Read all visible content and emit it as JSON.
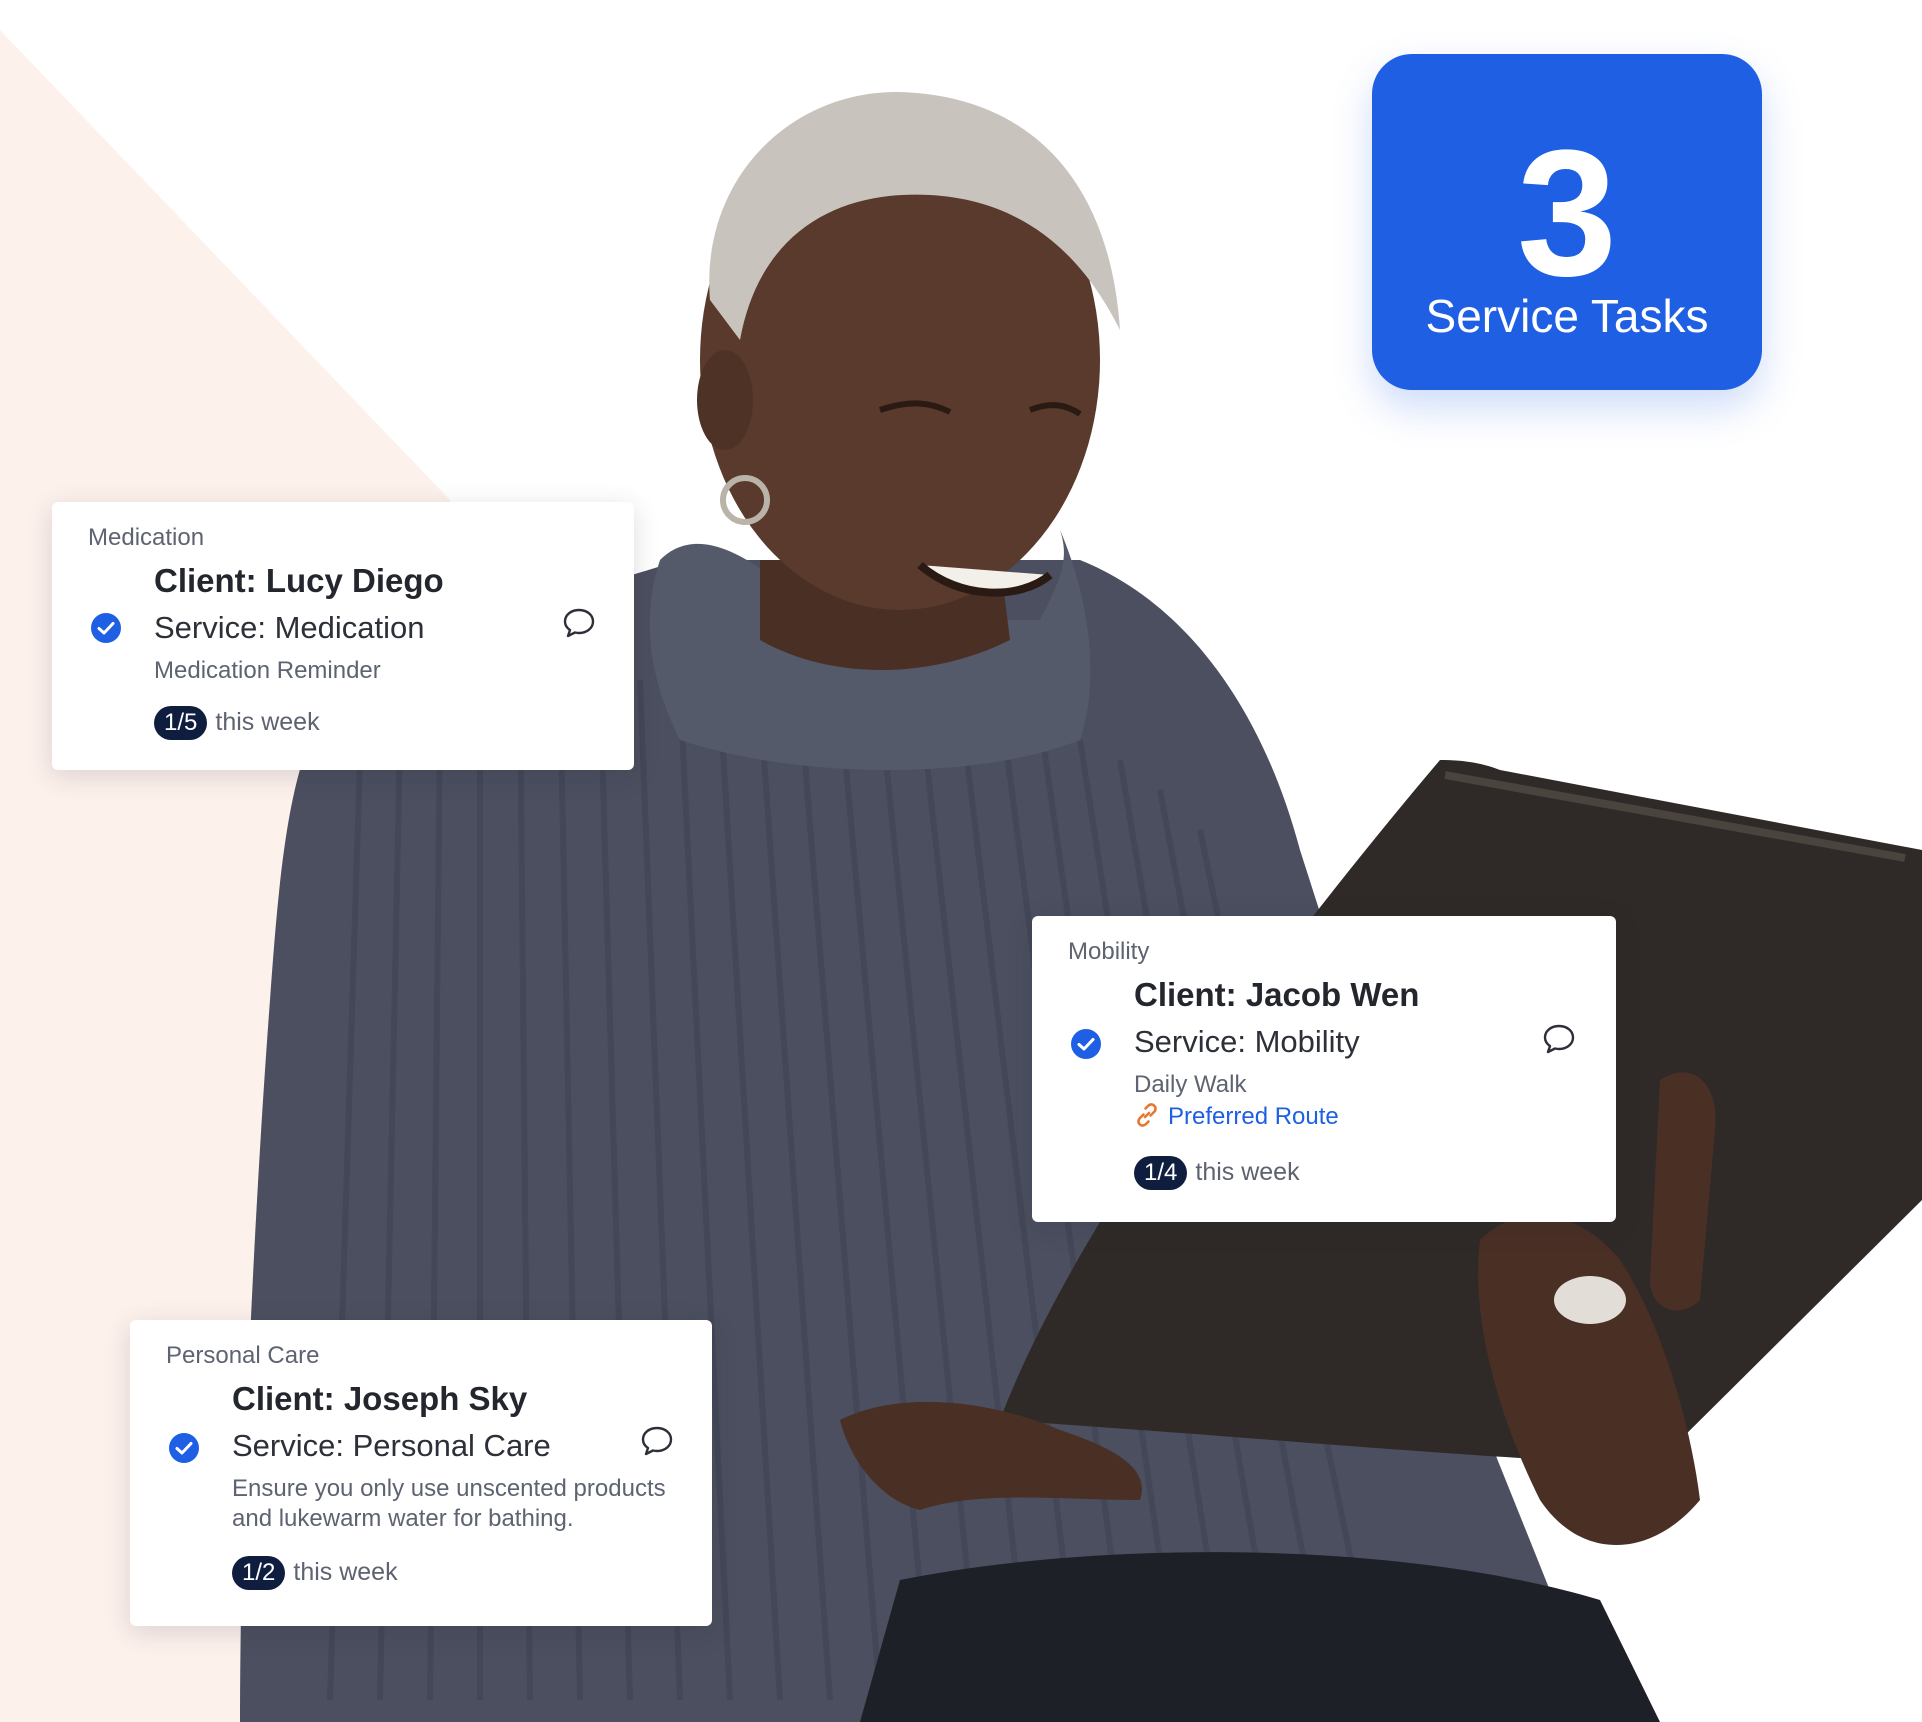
{
  "stat": {
    "number": "3",
    "label": "Service Tasks"
  },
  "cards": [
    {
      "category": "Medication",
      "client": "Client: Lucy Diego",
      "service": "Service: Medication",
      "note": "Medication Reminder",
      "progress": "1/5",
      "progress_suffix": "this week"
    },
    {
      "category": "Mobility",
      "client": "Client: Jacob Wen",
      "service": "Service: Mobility",
      "note": "Daily Walk",
      "link": "Preferred Route",
      "progress": "1/4",
      "progress_suffix": "this week"
    },
    {
      "category": "Personal Care",
      "client": "Client: Joseph Sky",
      "service": "Service: Personal Care",
      "note": "Ensure you only use unscented products and lukewarm water for bathing.",
      "progress": "1/2",
      "progress_suffix": "this week"
    }
  ],
  "icons": {
    "check": "check-circle-icon",
    "comment": "comment-icon",
    "link": "link-icon"
  },
  "colors": {
    "accent": "#1f5fe3",
    "badge": "#0f1e3f",
    "background_triangle": "#fdf1ec",
    "link_icon": "#e8772e"
  }
}
